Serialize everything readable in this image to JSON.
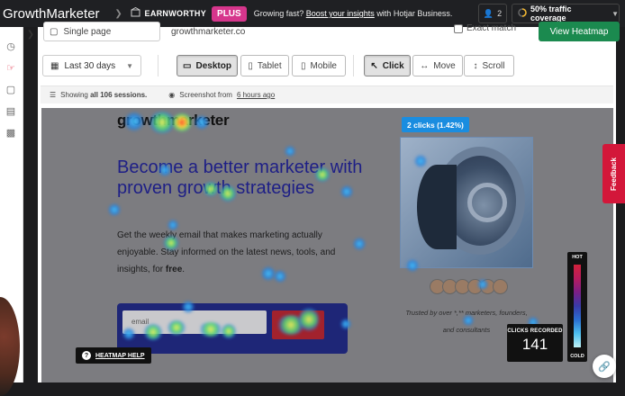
{
  "app": {
    "title": "GrowthMarketer"
  },
  "site": {
    "name": "EARNWORTHY",
    "plan_badge": "PLUS"
  },
  "promo": {
    "text": "Growing fast?",
    "link": "Boost your insights",
    "suffix": "with Hotjar Business."
  },
  "header": {
    "users_count": "2",
    "coverage_label": "50% traffic coverage"
  },
  "filters": {
    "page_select": "Single page",
    "url_value": "growthmarketer.co",
    "exact_match_label": "Exact match",
    "view_heatmap_label": "View Heatmap",
    "date_range": "Last 30 days"
  },
  "devices": [
    {
      "label": "Desktop",
      "active": true
    },
    {
      "label": "Tablet",
      "active": false
    },
    {
      "label": "Mobile",
      "active": false
    }
  ],
  "modes": [
    {
      "label": "Click",
      "active": true
    },
    {
      "label": "Move",
      "active": false
    },
    {
      "label": "Scroll",
      "active": false
    }
  ],
  "info_bar": {
    "showing_prefix": "Showing",
    "sessions": "all 106 sessions.",
    "screenshot_prefix": "Screenshot from",
    "screenshot_link": "6 hours ago"
  },
  "preview": {
    "logo": "growthmarketer",
    "headline": "Become a better marketer with proven growth strategies",
    "paragraph": "Get the weekly email that makes marketing actually enjoyable. Stay informed on the latest news, tools, and insights, for",
    "paragraph_bold": "free",
    "paragraph_end": ".",
    "email_placeholder": "email",
    "trust_line1": "Trusted by over *,** marketers, founders,",
    "trust_line2": "and consultants",
    "click_tag": "2 clicks (1.42%)"
  },
  "heatmap_help_label": "HEATMAP HELP",
  "clicks_recorded": {
    "label": "CLICKS RECORDED",
    "value": "141"
  },
  "legend": {
    "hot": "HOT",
    "cold": "COLD"
  },
  "feedback_label": "Feedback",
  "colors": {
    "accent_pink": "#d6368c",
    "cta_green": "#1b8a4f",
    "click_tag_blue": "#1a8de0",
    "feedback_red": "#d3173a"
  }
}
